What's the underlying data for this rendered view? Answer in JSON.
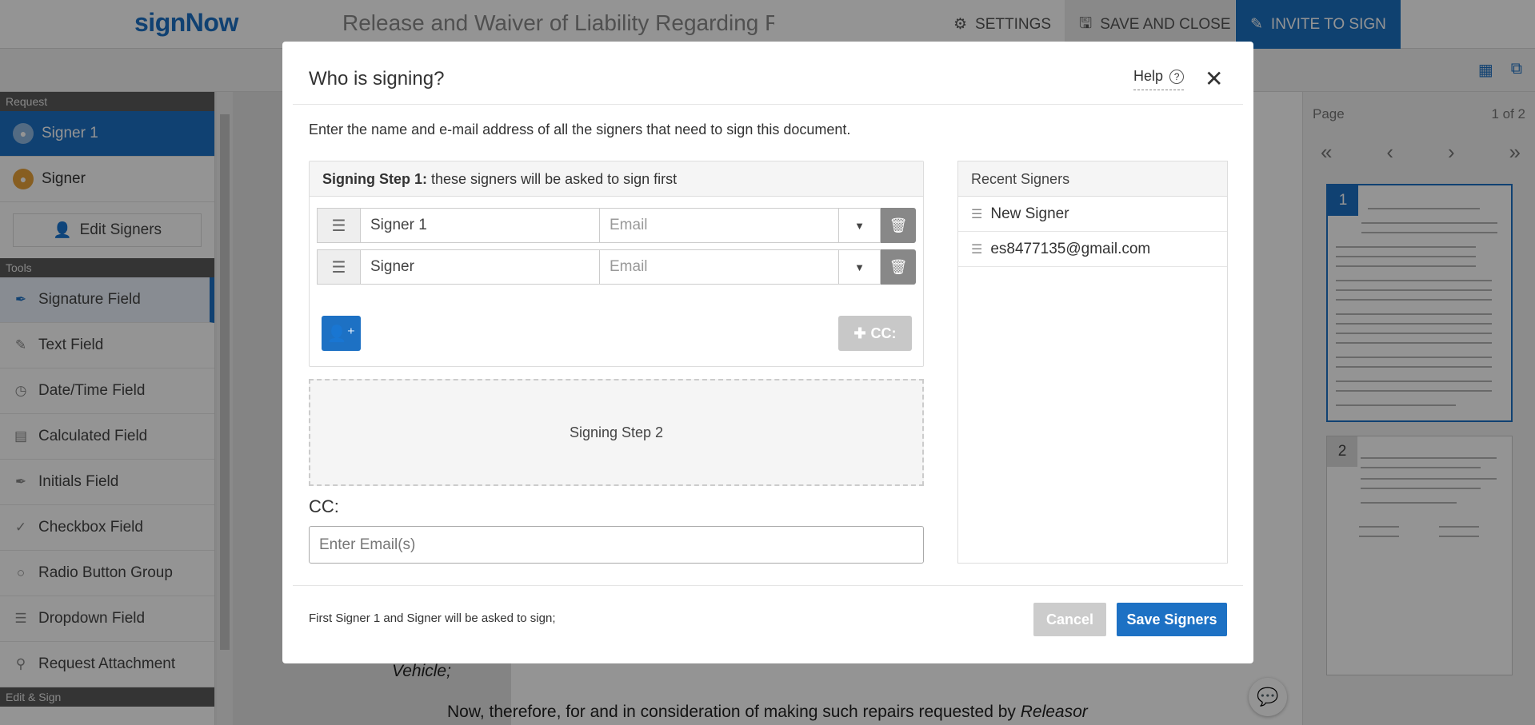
{
  "app": {
    "logo": "signNow",
    "document_title": "Release and Waiver of Liability Regarding Re",
    "settings_label": "SETTINGS",
    "save_close_label": "SAVE AND CLOSE",
    "invite_label": "INVITE TO SIGN",
    "accent_color": "#1d71c4"
  },
  "sidebar": {
    "request_header": "Request",
    "signers": [
      {
        "label": "Signer 1",
        "color": "#1d71c4"
      },
      {
        "label": "Signer",
        "color": "#e8a33a"
      }
    ],
    "edit_signers": "Edit Signers",
    "tools_header": "Tools",
    "tools": [
      {
        "label": "Signature Field",
        "icon": "pen-icon"
      },
      {
        "label": "Text Field",
        "icon": "pencil-icon"
      },
      {
        "label": "Date/Time Field",
        "icon": "clock-icon"
      },
      {
        "label": "Calculated Field",
        "icon": "calculator-icon"
      },
      {
        "label": "Initials Field",
        "icon": "pen-icon"
      },
      {
        "label": "Checkbox Field",
        "icon": "checkmark-icon"
      },
      {
        "label": "Radio Button Group",
        "icon": "radio-icon"
      },
      {
        "label": "Dropdown Field",
        "icon": "list-icon"
      },
      {
        "label": "Request Attachment",
        "icon": "paperclip-icon"
      }
    ],
    "edit_sign_header": "Edit & Sign"
  },
  "document": {
    "line1": "Vehicle;",
    "line2_prefix": "Now, therefore, for and in consideration of making such repairs requested by ",
    "line2_italic": "Releasor"
  },
  "pages_panel": {
    "label": "Page",
    "count": "1 of 2",
    "pages": [
      "1",
      "2"
    ]
  },
  "modal": {
    "title": "Who is signing?",
    "help": "Help",
    "description": "Enter the name and e-mail address of all the signers that need to sign this document.",
    "step1_bold": "Signing Step 1:",
    "step1_text": " these signers will be asked to sign first",
    "signers": [
      {
        "name": "Signer 1",
        "email_placeholder": "Email"
      },
      {
        "name": "Signer",
        "email_placeholder": "Email"
      }
    ],
    "cc_button": "CC:",
    "step2": "Signing Step 2",
    "cc_label": "CC:",
    "cc_placeholder": "Enter Email(s)",
    "recent_header": "Recent Signers",
    "recent": [
      "New Signer",
      "es8477135@gmail.com"
    ],
    "footer_text": "First Signer 1 and Signer will be asked to sign;",
    "cancel": "Cancel",
    "save": "Save Signers"
  }
}
